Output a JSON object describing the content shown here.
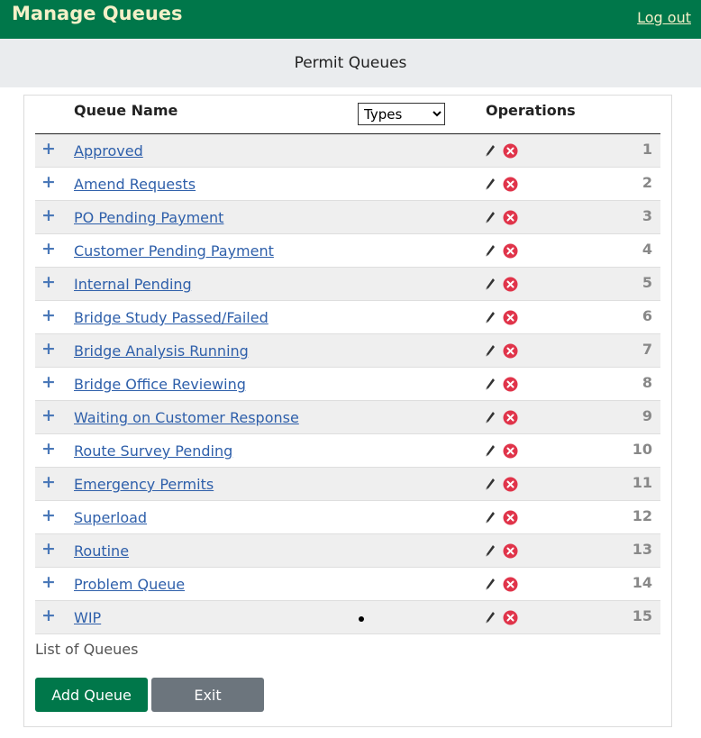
{
  "header": {
    "title": "Manage Queues",
    "logout_label": "Log out",
    "colors": {
      "topbar": "#00774a",
      "title_text": "#f4f0c8"
    }
  },
  "subheader": {
    "title": "Permit Queues"
  },
  "table": {
    "columns": {
      "queue_name": "Queue Name",
      "types_select": "Types",
      "operations": "Operations"
    },
    "rows": [
      {
        "name": "Approved",
        "number": "1",
        "has_dot": false
      },
      {
        "name": "Amend Requests",
        "number": "2",
        "has_dot": false
      },
      {
        "name": "PO Pending Payment",
        "number": "3",
        "has_dot": false
      },
      {
        "name": "Customer Pending Payment",
        "number": "4",
        "has_dot": false
      },
      {
        "name": "Internal Pending",
        "number": "5",
        "has_dot": false
      },
      {
        "name": "Bridge Study Passed/Failed",
        "number": "6",
        "has_dot": false
      },
      {
        "name": "Bridge Analysis Running",
        "number": "7",
        "has_dot": false
      },
      {
        "name": "Bridge Office Reviewing",
        "number": "8",
        "has_dot": false
      },
      {
        "name": "Waiting on Customer Response",
        "number": "9",
        "has_dot": false
      },
      {
        "name": "Route Survey Pending",
        "number": "10",
        "has_dot": false
      },
      {
        "name": "Emergency Permits",
        "number": "11",
        "has_dot": false
      },
      {
        "name": "Superload",
        "number": "12",
        "has_dot": false
      },
      {
        "name": "Routine",
        "number": "13",
        "has_dot": false
      },
      {
        "name": "Problem Queue",
        "number": "14",
        "has_dot": false
      },
      {
        "name": "WIP",
        "number": "15",
        "has_dot": true
      }
    ],
    "icons": {
      "expand": "plus-icon",
      "edit": "pencil-icon",
      "delete": "delete-x-circle-icon"
    },
    "caption": "List of Queues"
  },
  "actions": {
    "add_label": "Add Queue",
    "exit_label": "Exit",
    "colors": {
      "add": "#00774a",
      "exit": "#6c757d",
      "delete_icon": "#e0344a",
      "link": "#2e5faa"
    }
  }
}
